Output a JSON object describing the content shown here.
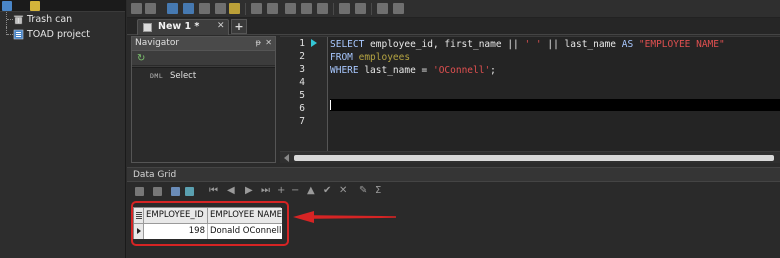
{
  "left_panel": {
    "tree": [
      {
        "label": "Trash can",
        "icon": "trash-can-icon"
      },
      {
        "label": "TOAD project",
        "icon": "project-icon"
      }
    ]
  },
  "tabs": {
    "active_label": "New 1 *",
    "close_glyph": "✕",
    "add_glyph": "+"
  },
  "navigator": {
    "title": "Navigator",
    "pin_glyph": "ᵽ",
    "close_glyph": "✕",
    "refresh_glyph": "↻",
    "item_prefix": "DML",
    "item_label": "Select"
  },
  "editor": {
    "line_numbers": [
      "1",
      "2",
      "3",
      "4",
      "5",
      "6",
      "7"
    ],
    "sql": {
      "line1": {
        "kw_select": "SELECT",
        "columns": " employee_id, first_name || ",
        "str_space": "' '",
        "concat": " || last_name ",
        "kw_as": "AS",
        "alias": " \"EMPLOYEE NAME\""
      },
      "line2": {
        "kw_from": "FROM",
        "table": " employees"
      },
      "line3": {
        "kw_where": "WHERE",
        "cond": " last_name = ",
        "value": "'OConnell'",
        "end": ";"
      }
    }
  },
  "data_grid": {
    "title": "Data Grid",
    "columns": [
      "EMPLOYEE_ID",
      "EMPLOYEE NAME"
    ],
    "rows": [
      [
        "198",
        "Donald OConnell"
      ]
    ]
  },
  "colors": {
    "annotation": "#d62424",
    "keyword": "#a8c8ff",
    "string": "#e05050",
    "table": "#b5a442",
    "exec_arrow": "#34c7d6"
  }
}
